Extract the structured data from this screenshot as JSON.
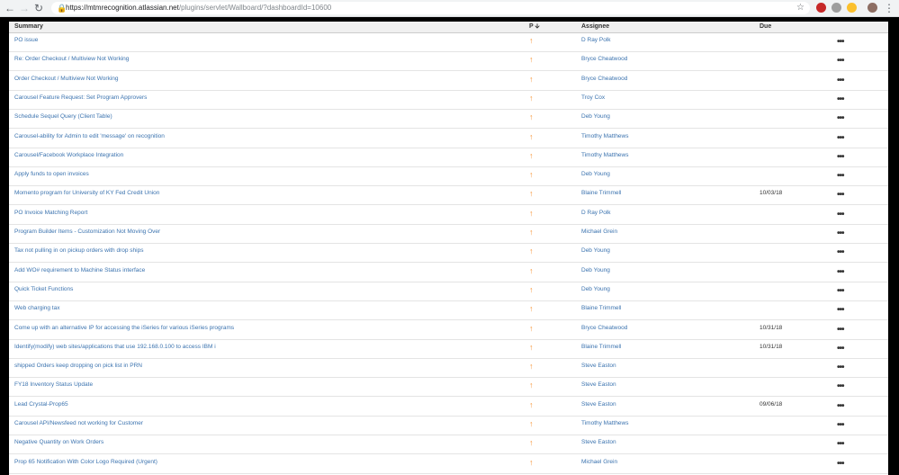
{
  "browser": {
    "url_host": "https://mtmrecognition.atlassian.net",
    "url_path": "/plugins/servlet/Wallboard/?dashboardId=10600"
  },
  "table": {
    "headers": {
      "summary": "Summary",
      "priority": "P",
      "assignee": "Assignee",
      "due": "Due"
    },
    "rows": [
      {
        "summary": "PO issue",
        "assignee": "D Ray Polk",
        "due": ""
      },
      {
        "summary": "Re: Order Checkout / Multiview Not Working",
        "assignee": "Bryce Cheatwood",
        "due": ""
      },
      {
        "summary": "Order Checkout / Multiview Not Working",
        "assignee": "Bryce Cheatwood",
        "due": ""
      },
      {
        "summary": "Carousel Feature Request: Set Program Approvers",
        "assignee": "Troy Cox",
        "due": ""
      },
      {
        "summary": "Schedule Sequel Query (Client Table)",
        "assignee": "Deb Young",
        "due": ""
      },
      {
        "summary": "Carousel-ability for Admin to edit 'message' on recognition",
        "assignee": "Timothy Matthews",
        "due": ""
      },
      {
        "summary": "Carousel/Facebook Workplace Integration",
        "assignee": "Timothy Matthews",
        "due": ""
      },
      {
        "summary": "Apply funds to open invoices",
        "assignee": "Deb Young",
        "due": ""
      },
      {
        "summary": "Momento program for University of KY Fed Credit Union",
        "assignee": "Blaine Trimmell",
        "due": "10/03/18"
      },
      {
        "summary": "PO Invoice Matching Report",
        "assignee": "D Ray Polk",
        "due": ""
      },
      {
        "summary": "Program Builder Items - Customization Not Moving Over",
        "assignee": "Michael Grein",
        "due": ""
      },
      {
        "summary": "Tax not pulling in on pickup orders with drop ships",
        "assignee": "Deb Young",
        "due": ""
      },
      {
        "summary": "Add WO# requirement to Machine Status interface",
        "assignee": "Deb Young",
        "due": ""
      },
      {
        "summary": "Quick Ticket Functions",
        "assignee": "Deb Young",
        "due": ""
      },
      {
        "summary": "Web charging tax",
        "assignee": "Blaine Trimmell",
        "due": ""
      },
      {
        "summary": "Come up with an alternative IP for accessing the iSeries for various iSeries programs",
        "assignee": "Bryce Cheatwood",
        "due": "10/31/18"
      },
      {
        "summary": "Identify(modify) web sites/applications that use 192.168.0.100 to access IBM i",
        "assignee": "Blaine Trimmell",
        "due": "10/31/18"
      },
      {
        "summary": "shipped Orders keep dropping on pick list in PRN",
        "assignee": "Steve Easton",
        "due": ""
      },
      {
        "summary": "FY18 Inventory Status Update",
        "assignee": "Steve Easton",
        "due": ""
      },
      {
        "summary": "Lead Crystal-Prop65",
        "assignee": "Steve Easton",
        "due": "09/06/18"
      },
      {
        "summary": "Carousel API/Newsfeed not working for Customer",
        "assignee": "Timothy Matthews",
        "due": ""
      },
      {
        "summary": "Negative Quantity on Work Orders",
        "assignee": "Steve Easton",
        "due": ""
      },
      {
        "summary": "Prop 65 Notification With Color Logo Required (Urgent)",
        "assignee": "Michael Grein",
        "due": ""
      }
    ]
  },
  "colors": {
    "priority_arrow": "#f79232",
    "link": "#3b73af"
  },
  "icons": {
    "priority": "arrow-up-icon",
    "more": "ellipsis-icon"
  }
}
